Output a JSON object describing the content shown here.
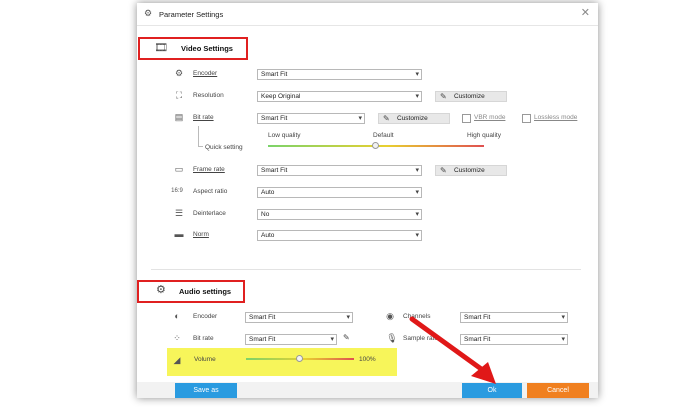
{
  "window": {
    "title": "Parameter Settings",
    "close_glyph": "✕"
  },
  "video": {
    "section_title": "Video Settings",
    "encoder": {
      "label": "Encoder",
      "value": "Smart Fit"
    },
    "resolution": {
      "label": "Resolution",
      "value": "Keep Original",
      "customize": "Customize"
    },
    "bitrate": {
      "label": "Bit rate",
      "value": "Smart Fit",
      "customize": "Customize",
      "vbr": "VBR mode",
      "lossless": "Lossless mode"
    },
    "quick": {
      "label": "Quick setting",
      "low": "Low quality",
      "default": "Default",
      "high": "High quality",
      "level": 0.5
    },
    "framerate": {
      "label": "Frame rate",
      "value": "Smart Fit",
      "customize": "Customize"
    },
    "aspect": {
      "label": "Aspect ratio",
      "value": "Auto"
    },
    "deinterlace": {
      "label": "Deinterlace",
      "value": "No"
    },
    "norm": {
      "label": "Norm",
      "value": "Auto"
    }
  },
  "audio": {
    "section_title": "Audio settings",
    "encoder": {
      "label": "Encoder",
      "value": "Smart Fit"
    },
    "bitrate": {
      "label": "Bit rate",
      "value": "Smart Fit"
    },
    "channels": {
      "label": "Channels",
      "value": "Smart Fit"
    },
    "samplerate": {
      "label": "Sample rate",
      "value": "Smart Fit"
    },
    "volume": {
      "label": "Volume",
      "value_text": "100%",
      "level": 0.5
    }
  },
  "footer": {
    "save_as": "Save as",
    "ok": "Ok",
    "cancel": "Cancel"
  },
  "colors": {
    "highlight_box": "#e02020",
    "volume_highlight": "#f7f55a",
    "save_btn": "#2a9be0",
    "ok_btn": "#2a9be0",
    "cancel_btn": "#f08020",
    "arrow": "#e01818"
  },
  "icons": [
    "settings-icon",
    "video-gear-icon",
    "encoder-icon",
    "resolution-icon",
    "bitrate-icon",
    "framerate-icon",
    "aspect-icon",
    "deinterlace-icon",
    "norm-icon",
    "audio-gear-icon",
    "audio-encoder-icon",
    "audio-bitrate-icon",
    "channels-icon",
    "samplerate-icon",
    "volume-icon",
    "pencil-icon",
    "close-icon"
  ]
}
